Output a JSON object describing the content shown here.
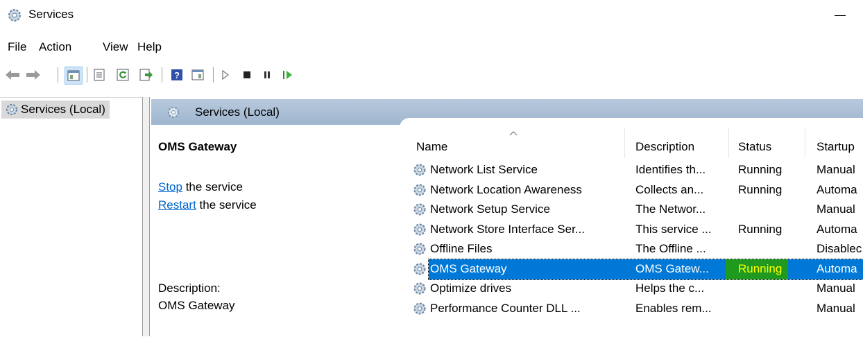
{
  "window": {
    "title": "Services"
  },
  "menu": [
    "File",
    "Action",
    "View",
    "Help"
  ],
  "tree": {
    "item": "Services (Local)"
  },
  "pane": {
    "header": "Services (Local)"
  },
  "details": {
    "service_name": "OMS Gateway",
    "stop_link": "Stop",
    "stop_suffix": " the service",
    "restart_link": "Restart",
    "restart_suffix": " the service",
    "description_label": "Description:",
    "description_text": "OMS Gateway"
  },
  "columns": {
    "name": "Name",
    "description": "Description",
    "status": "Status",
    "startup": "Startup"
  },
  "rows": [
    {
      "name": "Network List Service",
      "description": "Identifies th...",
      "status": "Running",
      "startup": "Manual"
    },
    {
      "name": "Network Location Awareness",
      "description": "Collects an...",
      "status": "Running",
      "startup": "Automa"
    },
    {
      "name": "Network Setup Service",
      "description": "The Networ...",
      "status": "",
      "startup": "Manual"
    },
    {
      "name": "Network Store Interface Ser...",
      "description": "This service ...",
      "status": "Running",
      "startup": "Automa"
    },
    {
      "name": "Offline Files",
      "description": "The Offline ...",
      "status": "",
      "startup": "Disablec"
    },
    {
      "name": "OMS Gateway",
      "description": "OMS Gatew...",
      "status": "Running",
      "startup": "Automa"
    },
    {
      "name": "Optimize drives",
      "description": "Helps the c...",
      "status": "",
      "startup": "Manual"
    },
    {
      "name": "Performance Counter DLL ...",
      "description": "Enables rem...",
      "status": "",
      "startup": "Manual"
    }
  ],
  "selected_row": "OMS Gateway",
  "colors": {
    "selection": "#0078d7",
    "status_highlight": "#1f9a1f",
    "status_text": "#ffff00",
    "link": "#0066cc",
    "header_gradient": "#b7c9dd"
  }
}
